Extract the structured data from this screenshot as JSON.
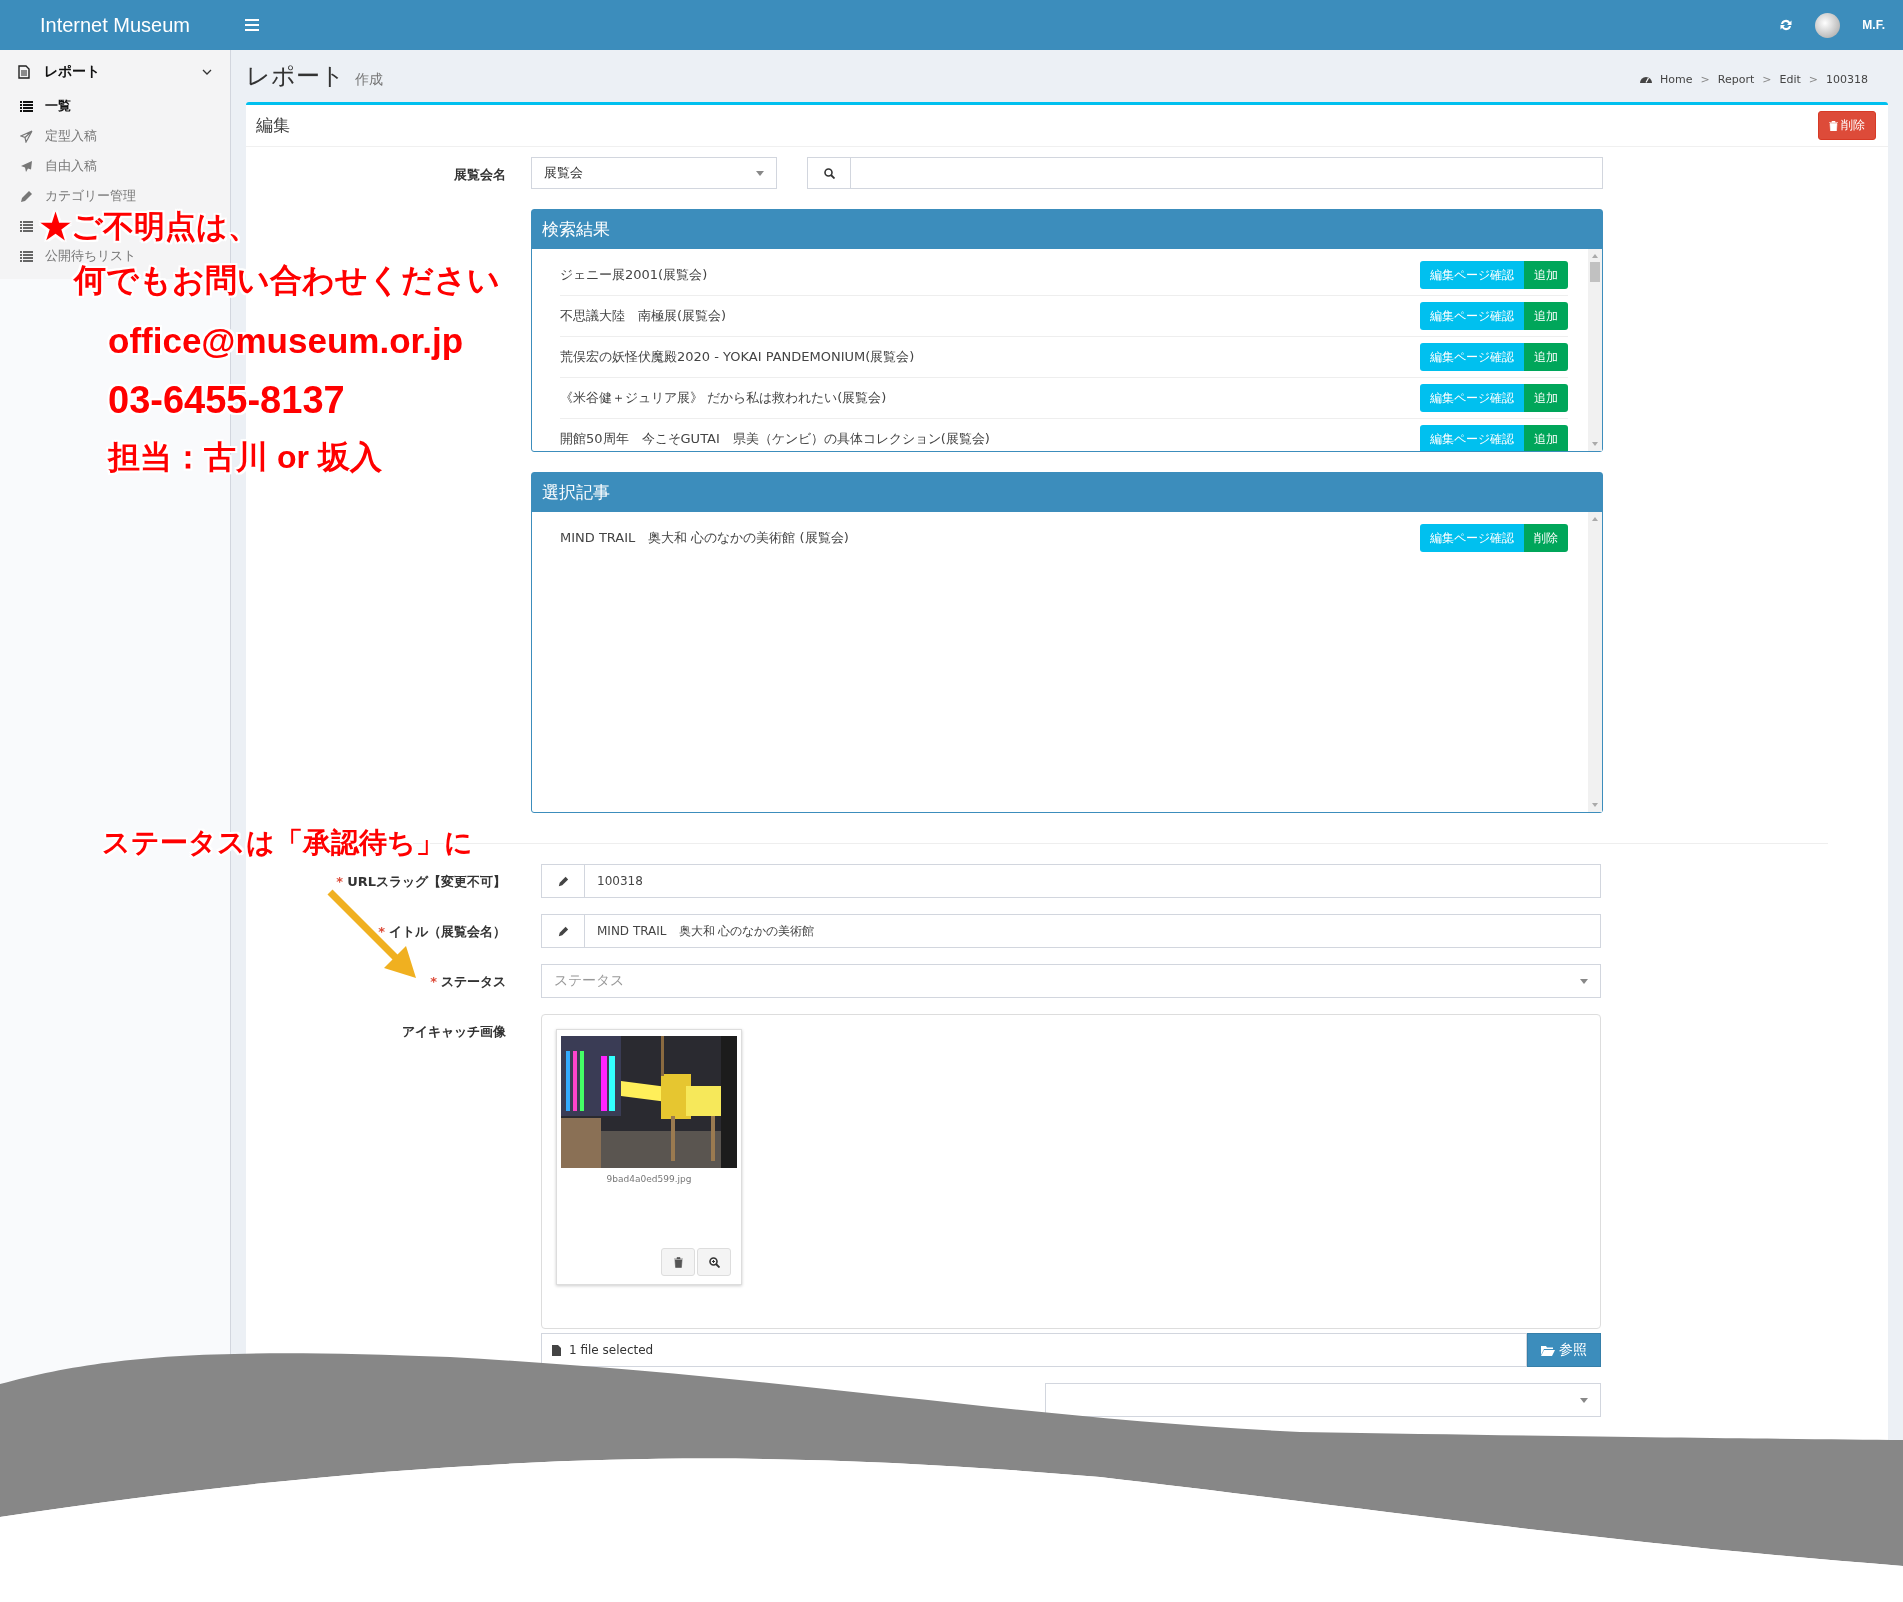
{
  "topbar": {
    "brand": "Internet Museum",
    "user": "M.F."
  },
  "sidebar": {
    "section": "レポート",
    "items": [
      {
        "kind": "list",
        "label": "一覧",
        "selected": true
      },
      {
        "kind": "plane-outline",
        "label": "定型入稿",
        "selected": false
      },
      {
        "kind": "plane",
        "label": "自由入稿",
        "selected": false
      },
      {
        "kind": "pencil",
        "label": "カテゴリー管理",
        "selected": false
      },
      {
        "kind": "list",
        "selected": false
      },
      {
        "kind": "list",
        "label": "公開待ちリスト",
        "selected": false
      }
    ]
  },
  "header": {
    "title": "レポート",
    "subtitle": "作成",
    "separator": ">",
    "breadcrumb": [
      "Home",
      "Report",
      "Edit",
      "100318"
    ]
  },
  "box": {
    "title": "編集",
    "delete_button": "削除"
  },
  "search": {
    "label": "展覧会名",
    "type_value": "展覧会"
  },
  "results": {
    "title": "検索結果",
    "rows": [
      {
        "text": "ジェニー展2001(展覧会)",
        "check": "編集ページ確認",
        "action": "追加"
      },
      {
        "text": "不思議大陸　南極展(展覧会)",
        "check": "編集ページ確認",
        "action": "追加"
      },
      {
        "text": "荒俣宏の妖怪伏魔殿2020 - YOKAI PANDEMONIUM(展覧会)",
        "check": "編集ページ確認",
        "action": "追加"
      },
      {
        "text": "《米谷健＋ジュリア展》 だから私は救われたい(展覧会)",
        "check": "編集ページ確認",
        "action": "追加"
      },
      {
        "text": "開館50周年　今こそGUTAI　県美（ケンビ）の具体コレクション(展覧会)",
        "check": "編集ページ確認",
        "action": "追加"
      }
    ]
  },
  "selected_articles": {
    "title": "選択記事",
    "rows": [
      {
        "text": "MIND TRAIL　奥大和 心のなかの美術館 (展覧会)",
        "check": "編集ページ確認",
        "action": "削除"
      }
    ]
  },
  "form": [
    {
      "kind": "text",
      "required_mark": "*",
      "label": "URLスラッグ【変更不可】",
      "value": "100318"
    },
    {
      "kind": "text",
      "required_mark": "*",
      "label": "イトル（展覧会名）",
      "value": "MIND TRAIL　奥大和 心のなかの美術館"
    },
    {
      "kind": "select",
      "required_mark": "*",
      "label": "ステータス",
      "placeholder": "ステータス"
    },
    {
      "label": "アイキャッチ画像",
      "filename": "9bad4a0ed599.jpg",
      "file_status": "1 file selected",
      "browse": "参照"
    },
    {
      "kind": "select"
    }
  ],
  "annotations": {
    "lines": [
      "★ご不明点は、",
      "何でもお問い合わせください",
      "office@museum.or.jp",
      "03-6455-8137",
      "担当：古川 or 坂入"
    ],
    "note": "ステータスは「承認待ち」に"
  }
}
